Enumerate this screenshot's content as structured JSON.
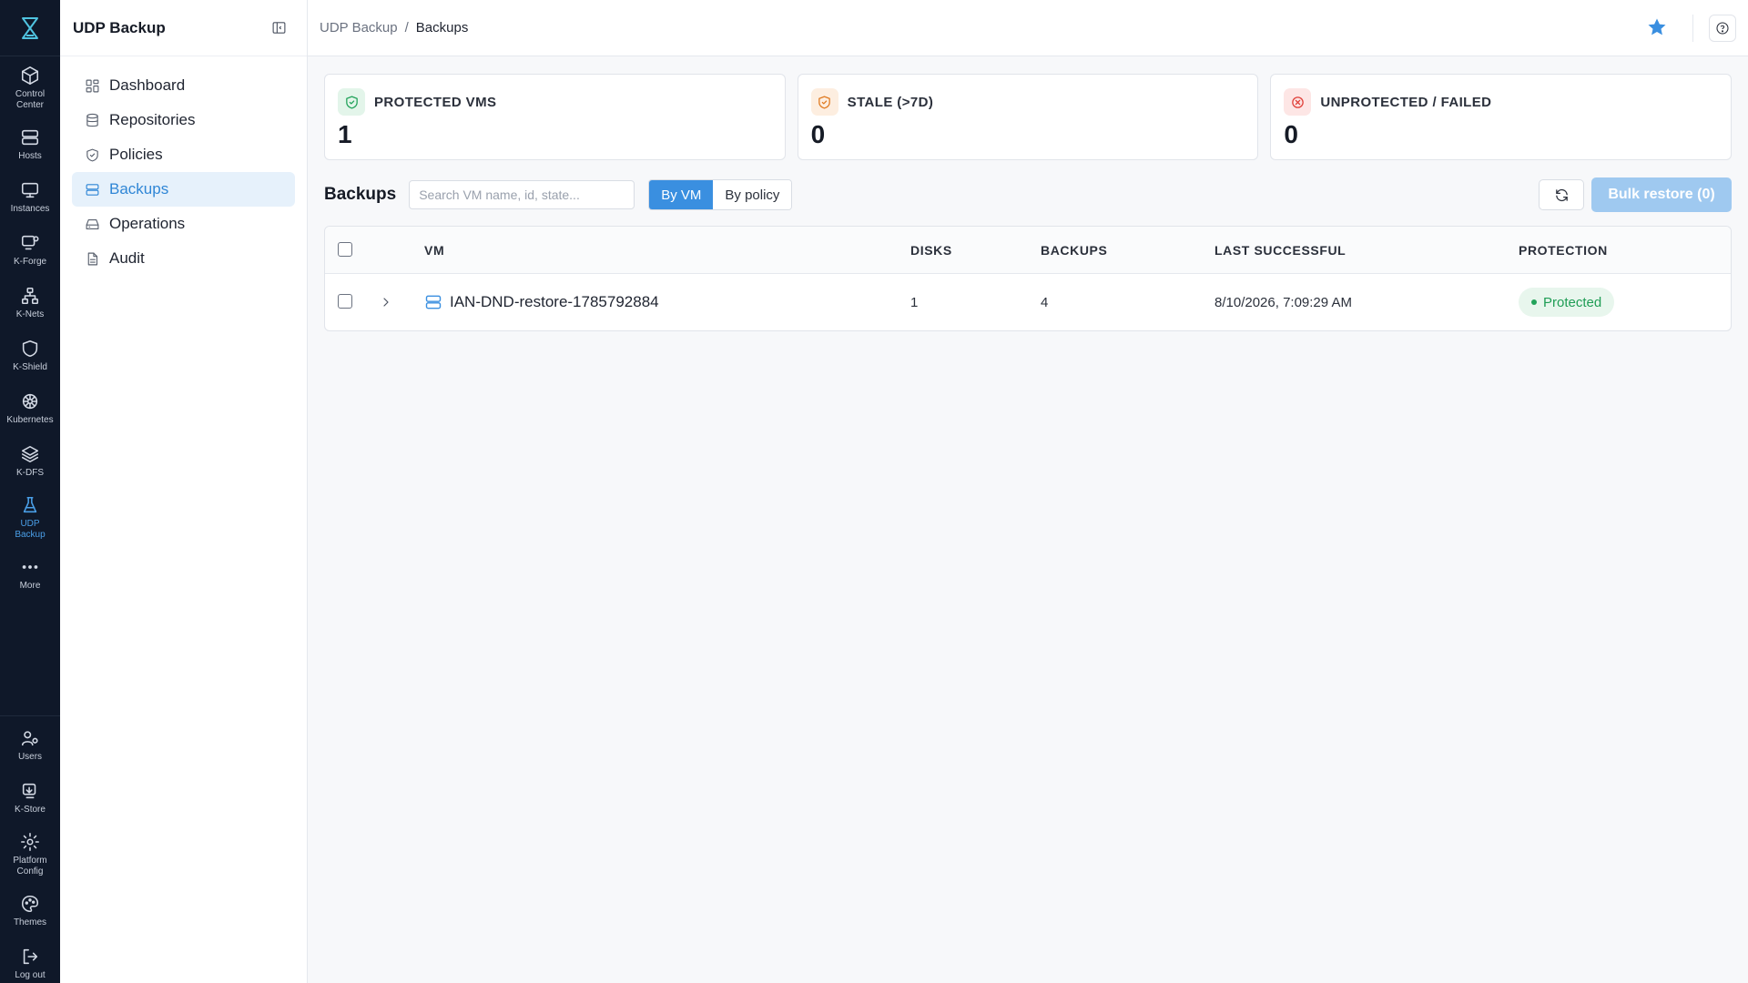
{
  "rail": {
    "items": [
      {
        "label": "Control\nCenter",
        "icon": "cube-icon"
      },
      {
        "label": "Hosts",
        "icon": "server-icon"
      },
      {
        "label": "Instances",
        "icon": "monitor-icon"
      },
      {
        "label": "K-Forge",
        "icon": "monitor-gear-icon"
      },
      {
        "label": "K-Nets",
        "icon": "network-icon"
      },
      {
        "label": "K-Shield",
        "icon": "shield-icon"
      },
      {
        "label": "Kubernetes",
        "icon": "helm-icon"
      },
      {
        "label": "K-DFS",
        "icon": "layers-icon"
      },
      {
        "label": "UDP\nBackup",
        "icon": "flask-icon",
        "active": true
      },
      {
        "label": "More",
        "icon": "ellipsis-icon"
      }
    ],
    "bottom_items": [
      {
        "label": "Users",
        "icon": "users-icon"
      },
      {
        "label": "K-Store",
        "icon": "store-icon"
      },
      {
        "label": "Platform\nConfig",
        "icon": "gear-icon"
      },
      {
        "label": "Themes",
        "icon": "palette-icon"
      },
      {
        "label": "Log out",
        "icon": "logout-icon"
      }
    ]
  },
  "sidebar": {
    "title": "UDP Backup",
    "items": [
      {
        "label": "Dashboard",
        "icon": "grid-icon"
      },
      {
        "label": "Repositories",
        "icon": "database-icon"
      },
      {
        "label": "Policies",
        "icon": "shield-check-icon"
      },
      {
        "label": "Backups",
        "icon": "server-icon",
        "active": true
      },
      {
        "label": "Operations",
        "icon": "hard-drive-icon"
      },
      {
        "label": "Audit",
        "icon": "file-text-icon"
      }
    ]
  },
  "breadcrumb": {
    "root": "UDP Backup",
    "separator": "/",
    "current": "Backups"
  },
  "stats": [
    {
      "label": "PROTECTED VMS",
      "value": "1",
      "icon": "shield-check-icon",
      "color": "#22a35a",
      "bg": "#e3f5ea"
    },
    {
      "label": "STALE (>7D)",
      "value": "0",
      "icon": "shield-warn-icon",
      "color": "#e07b22",
      "bg": "#fdeee0"
    },
    {
      "label": "UNPROTECTED / FAILED",
      "value": "0",
      "icon": "x-circle-icon",
      "color": "#e0413a",
      "bg": "#fde6e5"
    }
  ],
  "toolbar": {
    "title": "Backups",
    "search_placeholder": "Search VM name, id, state...",
    "search_value": "",
    "view_by_vm": "By VM",
    "view_by_policy": "By policy",
    "bulk_restore": "Bulk restore (0)"
  },
  "table": {
    "columns": [
      "VM",
      "DISKS",
      "BACKUPS",
      "LAST SUCCESSFUL",
      "PROTECTION"
    ],
    "rows": [
      {
        "vm": "IAN-DND-restore-1785792884",
        "disks": "1",
        "backups": "4",
        "last_successful": "8/10/2026, 7:09:29 AM",
        "protection": "Protected"
      }
    ]
  },
  "colors": {
    "accent": "#3a8fe0",
    "rail_bg": "#0f1829",
    "protected": "#1f9d55"
  }
}
